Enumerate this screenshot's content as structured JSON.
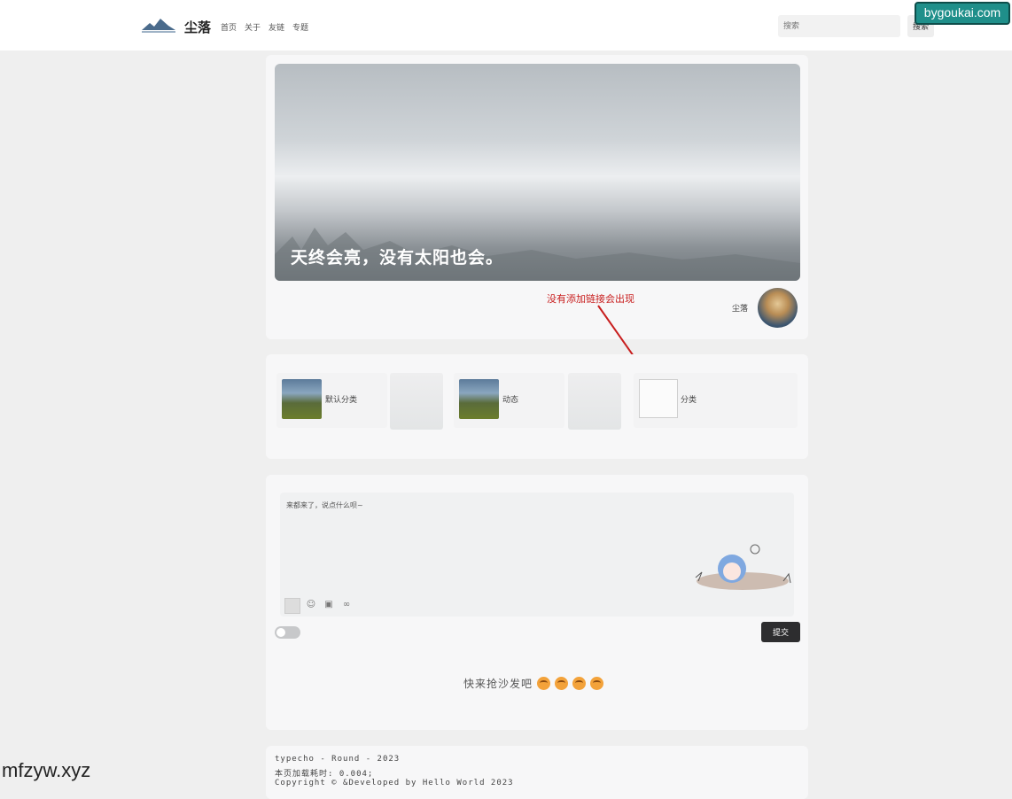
{
  "header": {
    "site_name": "尘落",
    "nav": [
      "首页",
      "关于",
      "友链",
      "专题"
    ],
    "search_placeholder": "搜索",
    "search_button": "搜索"
  },
  "watermarks": {
    "top_right": "bygoukai.com",
    "bottom_left": "mfzyw.xyz"
  },
  "hero": {
    "title": "天终会亮，没有太阳也会。"
  },
  "annotation": "没有添加链接会出现",
  "author": {
    "name": "尘落"
  },
  "categories": [
    {
      "label": "默认分类"
    },
    {
      "label": "动态"
    },
    {
      "label": "分类"
    }
  ],
  "comment": {
    "placeholder": "来都来了，说点什么呗~",
    "submit": "提交",
    "empty_text": "快来抢沙发吧"
  },
  "footer": {
    "line1": "typecho - Round - 2023",
    "line2": "本页加载耗时: 0.004;",
    "line3": "Copyright © &Developed by Hello World 2023"
  },
  "colors": {
    "accent": "#2d2d2f",
    "annotation": "#c81e1e",
    "badge": "#1f8f8a"
  }
}
